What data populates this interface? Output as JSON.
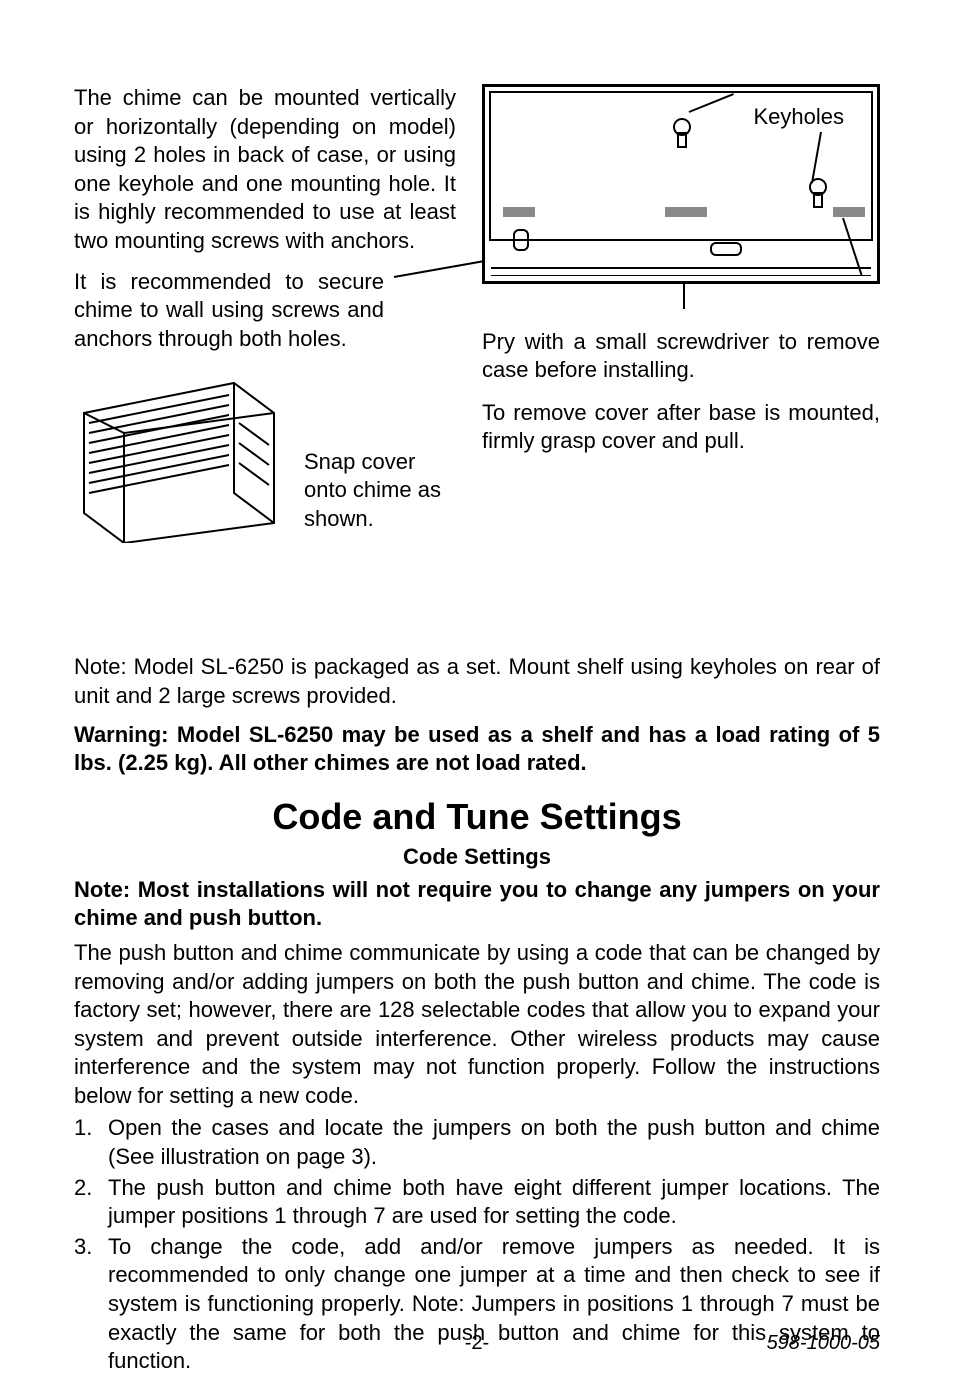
{
  "p1": "The chime can be mounted vertically or horizontally (depending on model) using 2 holes in back of case, or using one keyhole and one mounting hole. It is highly recommended to use at least two mounting screws with anchors.",
  "p2": "It is recommended to  secure chime to wall using screws and anchors through both holes.",
  "keyholes_label": "Keyholes",
  "snap_caption": "Snap cover onto chime as shown.",
  "pry_text": "Pry with a small screwdriver to remove case before installing.",
  "remove_text": "To remove cover after base is mounted, firmly grasp cover and pull.",
  "note1": "Note: Model SL-6250 is packaged as a set. Mount shelf using keyholes on rear of unit and 2 large screws provided.",
  "warning": "Warning: Model SL-6250 may be used as a shelf and has a load rating of 5 lbs. (2.25 kg). All other chimes are not load rated.",
  "h1": "Code and Tune Settings",
  "sub": "Code Settings",
  "note2": "Note: Most installations will not require you to change any jumpers on your chime and push button.",
  "body": "The push button and chime communicate by using a code that can be changed by removing and/or adding jumpers on both the push button and chime. The code is factory set; however, there are 128 selectable codes that allow you to expand your system and prevent outside interference. Other wireless products may cause interference and the system may not function properly. Follow the instructions below for setting a new code.",
  "list": {
    "items": [
      {
        "num": "1.",
        "text": "Open the cases and locate the jumpers on both the push button and chime (See illustration on page 3)."
      },
      {
        "num": "2.",
        "text": "The push button and chime both have eight different jumper locations. The jumper positions 1 through 7 are used for setting the code."
      },
      {
        "num": "3.",
        "text": "To change the code, add and/or remove jumpers as needed. It is recommended to only change one jumper at a time and then check to see if system is functioning properly. Note: Jumpers in positions 1 through 7 must be exactly the same for both the push button and chime for this system to function."
      }
    ]
  },
  "footer": {
    "page": "-2-",
    "doc": "598-1000-05"
  }
}
